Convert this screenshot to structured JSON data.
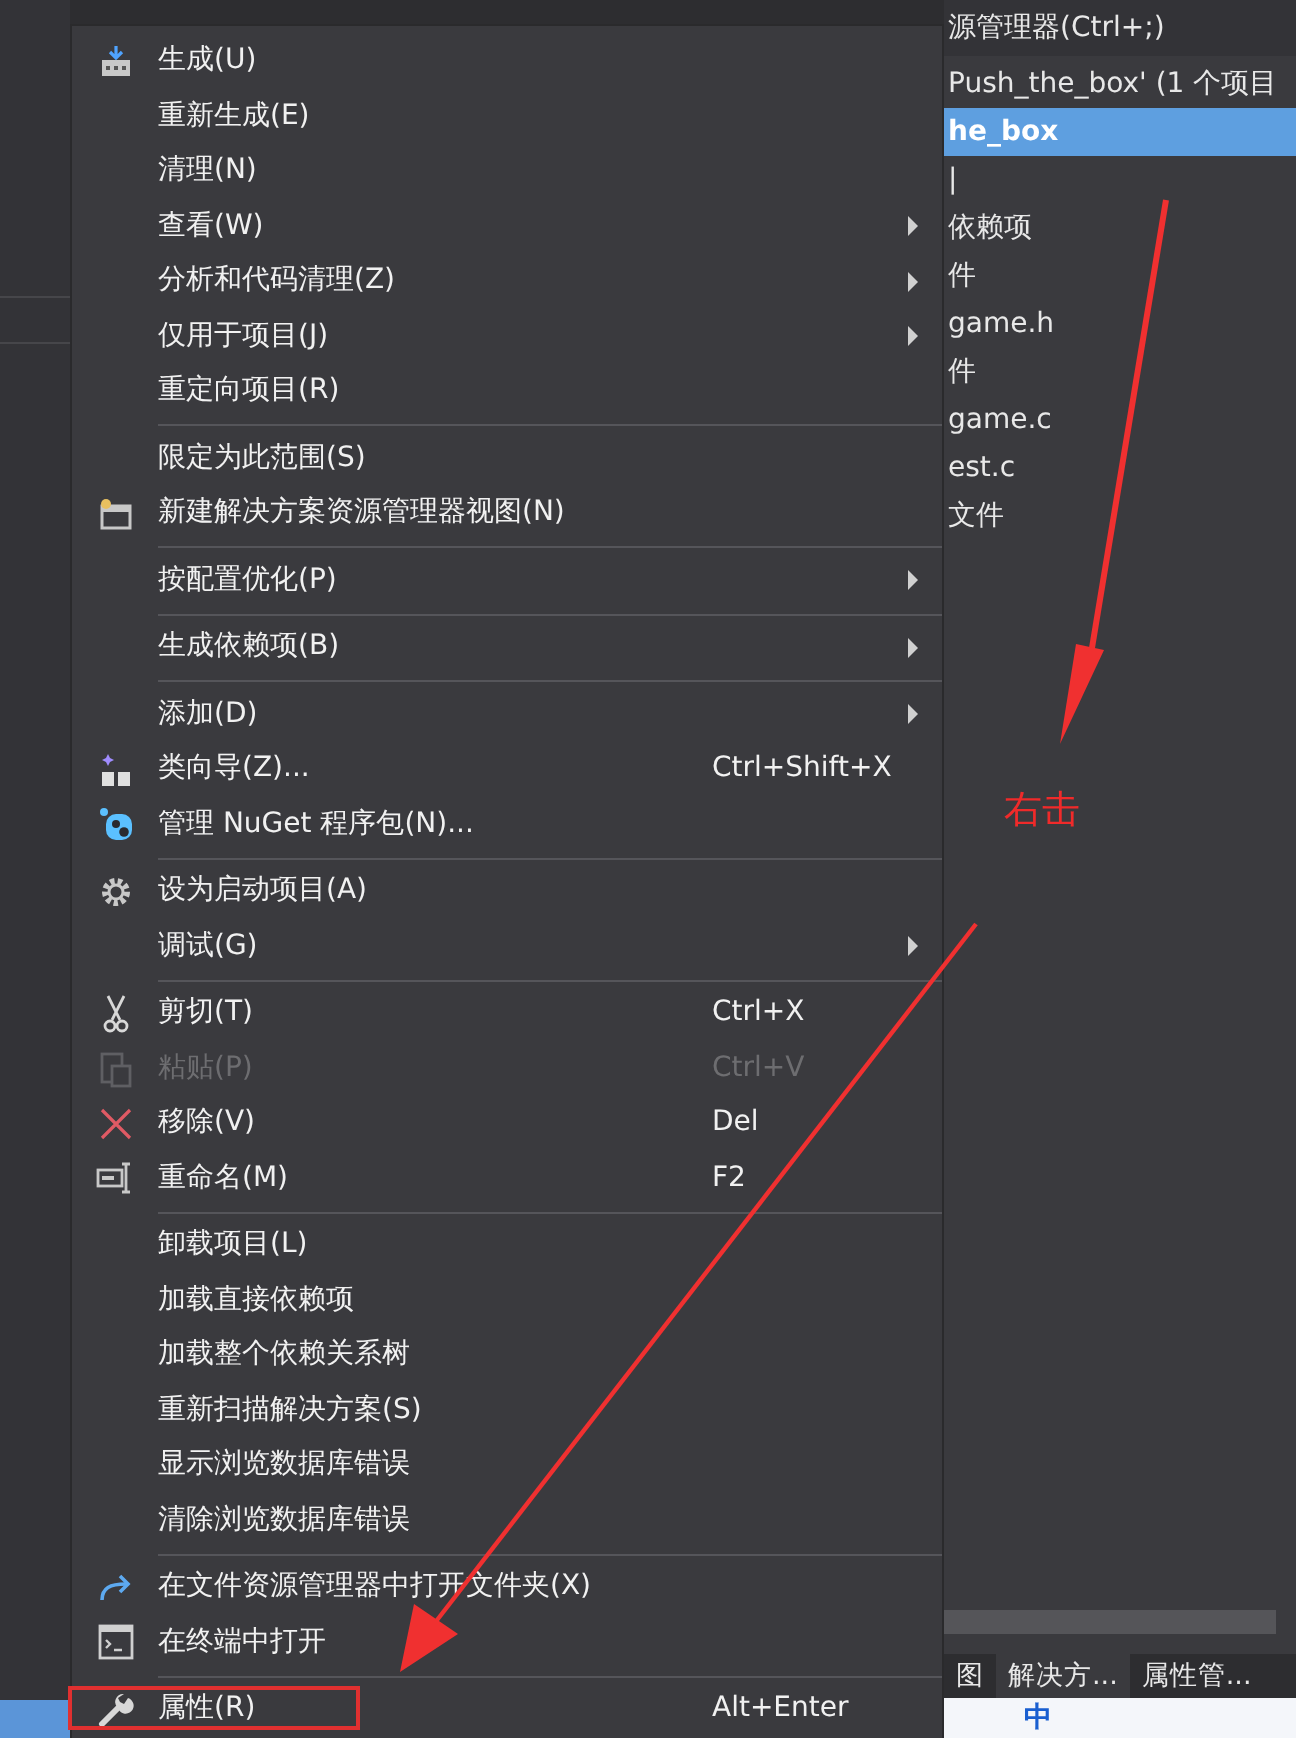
{
  "solution_explorer": {
    "search": "源管理器(Ctrl+;)",
    "tree": [
      {
        "label": "Push_the_box' (1 个项目",
        "selected": false
      },
      {
        "label": "he_box",
        "selected": true
      },
      {
        "label": "|",
        "selected": false
      },
      {
        "label": "依赖项",
        "selected": false
      },
      {
        "label": "件",
        "selected": false
      },
      {
        "label": "game.h",
        "selected": false
      },
      {
        "label": "件",
        "selected": false
      },
      {
        "label": "game.c",
        "selected": false
      },
      {
        "label": "est.c",
        "selected": false
      },
      {
        "label": "文件",
        "selected": false
      }
    ],
    "tabs": [
      {
        "label": "图",
        "selected": false
      },
      {
        "label": "解决方...",
        "selected": true
      },
      {
        "label": "属性管...",
        "selected": false
      }
    ]
  },
  "ime_bar": {
    "label": "中"
  },
  "context_menu": {
    "groups": [
      [
        {
          "label": "生成(U)",
          "submenu": false,
          "disabled": false,
          "highlighted": false
        },
        {
          "label": "重新生成(E)",
          "submenu": false,
          "disabled": false,
          "highlighted": false
        },
        {
          "label": "清理(N)",
          "submenu": false,
          "disabled": false,
          "highlighted": false
        },
        {
          "label": "查看(W)",
          "submenu": true,
          "disabled": false,
          "highlighted": false
        },
        {
          "label": "分析和代码清理(Z)",
          "submenu": true,
          "disabled": false,
          "highlighted": false
        },
        {
          "label": "仅用于项目(J)",
          "submenu": true,
          "disabled": false,
          "highlighted": false
        },
        {
          "label": "重定向项目(R)",
          "submenu": false,
          "disabled": false,
          "highlighted": false
        }
      ],
      [
        {
          "label": "限定为此范围(S)",
          "submenu": false,
          "disabled": false,
          "highlighted": false
        },
        {
          "label": "新建解决方案资源管理器视图(N)",
          "submenu": false,
          "disabled": false,
          "highlighted": false
        }
      ],
      [
        {
          "label": "按配置优化(P)",
          "submenu": true,
          "disabled": false,
          "highlighted": false
        }
      ],
      [
        {
          "label": "生成依赖项(B)",
          "submenu": true,
          "disabled": false,
          "highlighted": false
        }
      ],
      [
        {
          "label": "添加(D)",
          "submenu": true,
          "disabled": false,
          "highlighted": false
        },
        {
          "label": "类向导(Z)...",
          "shortcut": "Ctrl+Shift+X",
          "submenu": false,
          "disabled": false,
          "highlighted": false
        },
        {
          "label": "管理 NuGet 程序包(N)...",
          "submenu": false,
          "disabled": false,
          "highlighted": false
        }
      ],
      [
        {
          "label": "设为启动项目(A)",
          "submenu": false,
          "disabled": false,
          "highlighted": false
        },
        {
          "label": "调试(G)",
          "submenu": true,
          "disabled": false,
          "highlighted": false
        }
      ],
      [
        {
          "label": "剪切(T)",
          "shortcut": "Ctrl+X",
          "submenu": false,
          "disabled": false,
          "highlighted": false
        },
        {
          "label": "粘贴(P)",
          "shortcut": "Ctrl+V",
          "submenu": false,
          "disabled": true,
          "highlighted": false
        },
        {
          "label": "移除(V)",
          "shortcut": "Del",
          "submenu": false,
          "disabled": false,
          "highlighted": false
        },
        {
          "label": "重命名(M)",
          "shortcut": "F2",
          "submenu": false,
          "disabled": false,
          "highlighted": false
        }
      ],
      [
        {
          "label": "卸载项目(L)",
          "submenu": false,
          "disabled": false,
          "highlighted": false
        },
        {
          "label": "加载直接依赖项",
          "submenu": false,
          "disabled": false,
          "highlighted": false
        },
        {
          "label": "加载整个依赖关系树",
          "submenu": false,
          "disabled": false,
          "highlighted": false
        },
        {
          "label": "重新扫描解决方案(S)",
          "submenu": false,
          "disabled": false,
          "highlighted": false
        },
        {
          "label": "显示浏览数据库错误",
          "submenu": false,
          "disabled": false,
          "highlighted": false
        },
        {
          "label": "清除浏览数据库错误",
          "submenu": false,
          "disabled": false,
          "highlighted": false
        }
      ],
      [
        {
          "label": "在文件资源管理器中打开文件夹(X)",
          "submenu": false,
          "disabled": false,
          "highlighted": false
        },
        {
          "label": "在终端中打开",
          "submenu": false,
          "disabled": false,
          "highlighted": false
        }
      ],
      [
        {
          "label": "属性(R)",
          "shortcut": "Alt+Enter",
          "submenu": false,
          "disabled": false,
          "highlighted": true
        }
      ]
    ]
  },
  "annotation": {
    "label": "右击"
  }
}
